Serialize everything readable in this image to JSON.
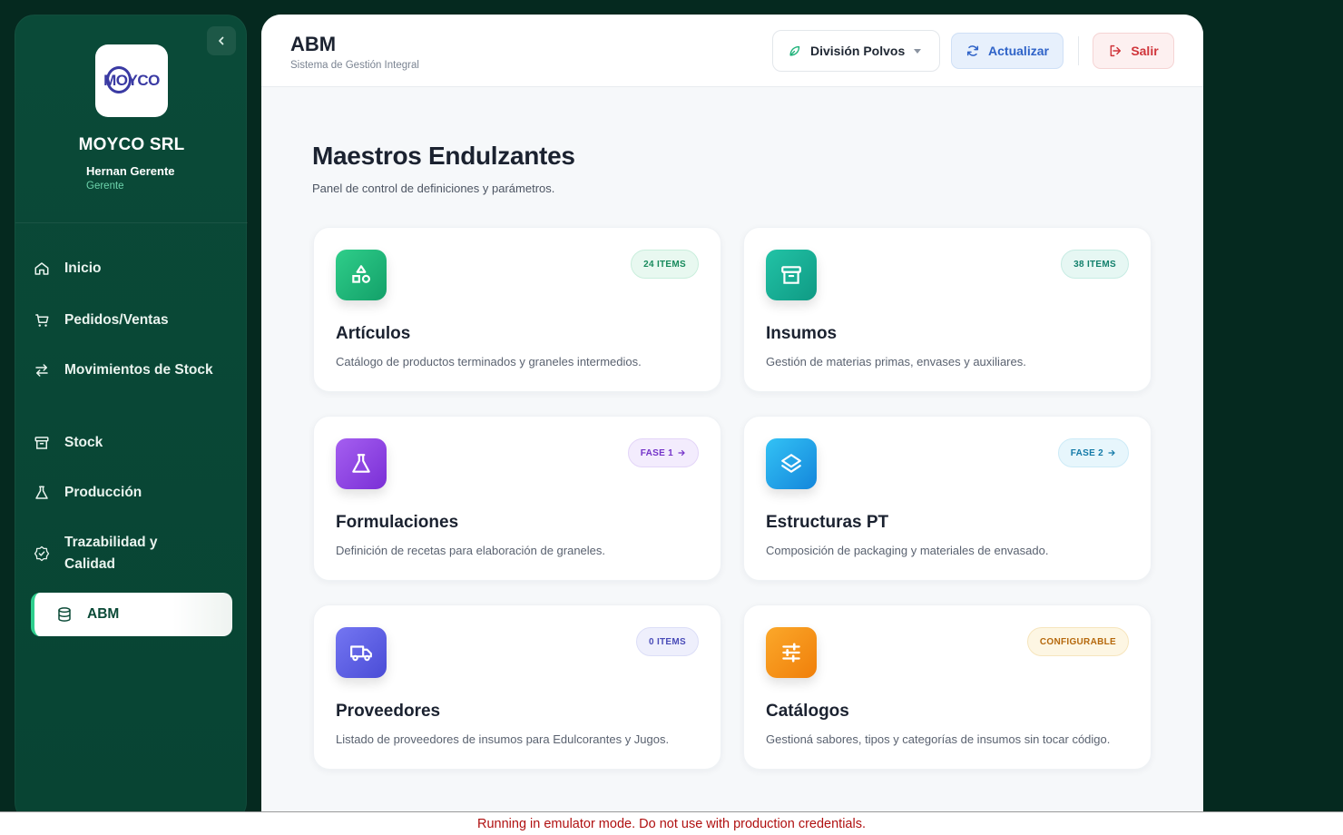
{
  "sidebar": {
    "company": "MOYCO SRL",
    "logo_text": "MOYCO",
    "user_name": "Hernan Gerente",
    "user_role": "Gerente",
    "items": [
      {
        "label": "Inicio",
        "icon": "home-icon"
      },
      {
        "label": "Pedidos/Ventas",
        "icon": "cart-icon"
      },
      {
        "label": "Movimientos de Stock",
        "icon": "arrows-swap-icon"
      },
      {
        "label": "Stock",
        "icon": "archive-icon"
      },
      {
        "label": "Producción",
        "icon": "flask-icon"
      },
      {
        "label": "Trazabilidad y Calidad",
        "icon": "badge-check-icon"
      },
      {
        "label": "ABM",
        "icon": "database-icon",
        "active": true
      }
    ]
  },
  "header": {
    "title": "ABM",
    "subtitle": "Sistema de Gestión Integral",
    "division": "División Polvos",
    "refresh_label": "Actualizar",
    "logout_label": "Salir"
  },
  "page": {
    "title": "Maestros Endulzantes",
    "subtitle": "Panel de control de definiciones y parámetros."
  },
  "cards": [
    {
      "title": "Artículos",
      "description": "Catálogo de productos terminados y graneles intermedios.",
      "badge": "24 ITEMS",
      "icon": "shapes-icon",
      "accent": "#1fb27a"
    },
    {
      "title": "Insumos",
      "description": "Gestión de materias primas, envases y auxiliares.",
      "badge": "38 ITEMS",
      "icon": "archive-icon",
      "accent": "#17a893"
    },
    {
      "title": "Formulaciones",
      "description": "Definición de recetas para elaboración de graneles.",
      "badge": "FASE 1",
      "icon": "flask-icon",
      "accent": "#8b3fe0"
    },
    {
      "title": "Estructuras PT",
      "description": "Composición de packaging y materiales de envasado.",
      "badge": "FASE 2",
      "icon": "layers-icon",
      "accent": "#1aa0e6"
    },
    {
      "title": "Proveedores",
      "description": "Listado de proveedores de insumos para Edulcorantes y Jugos.",
      "badge": "0 ITEMS",
      "icon": "truck-icon",
      "accent": "#5a5ce0"
    },
    {
      "title": "Catálogos",
      "description": "Gestioná sabores, tipos y categorías de insumos sin tocar código.",
      "badge": "CONFIGURABLE",
      "icon": "sliders-icon",
      "accent": "#f5910f"
    }
  ],
  "footer": {
    "message": "Running in emulator mode. Do not use with production credentials."
  }
}
